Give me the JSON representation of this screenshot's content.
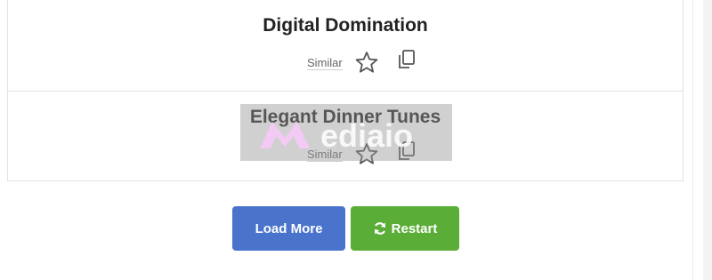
{
  "results": [
    {
      "title": "Digital Domination",
      "similar_label": "Similar"
    },
    {
      "title": "Elegant Dinner Tunes",
      "similar_label": "Similar"
    }
  ],
  "watermark": {
    "text": "Mediaio"
  },
  "buttons": {
    "load_more": "Load More",
    "restart": "Restart"
  },
  "colors": {
    "load_more_bg": "#4a74cc",
    "restart_bg": "#5aad37",
    "border": "#e3e3e3"
  },
  "icons": [
    "star-icon",
    "copy-icon",
    "refresh-icon"
  ]
}
